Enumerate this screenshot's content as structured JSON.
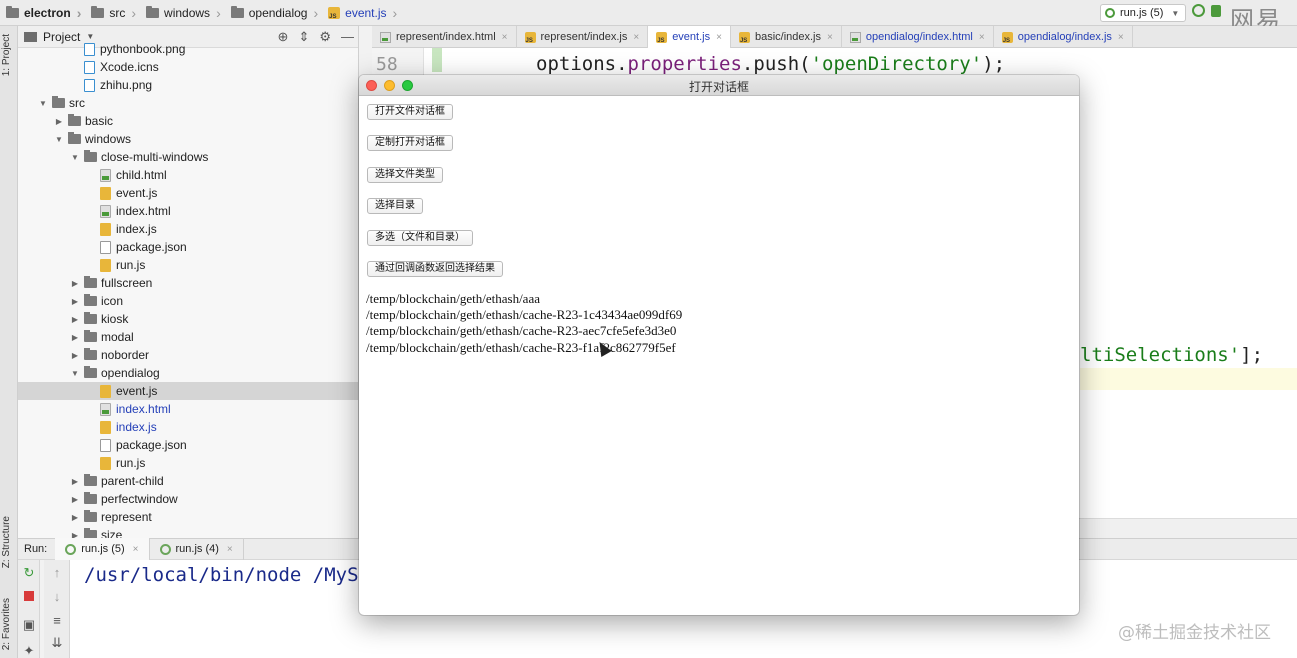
{
  "breadcrumb": {
    "items": [
      "electron",
      "src",
      "windows",
      "opendialog",
      "event.js"
    ]
  },
  "run_config": {
    "label": "run.js (5)"
  },
  "watermark_top": "网易",
  "side_strip": {
    "project": "1: Project",
    "structure": "Z: Structure",
    "favorites": "2: Favorites"
  },
  "project_panel": {
    "title": "Project",
    "tree": [
      {
        "label": "pythonbook.png",
        "type": "png",
        "depth": 3,
        "expanded": null
      },
      {
        "label": "Xcode.icns",
        "type": "png",
        "depth": 3,
        "expanded": null
      },
      {
        "label": "zhihu.png",
        "type": "png",
        "depth": 3,
        "expanded": null
      },
      {
        "label": "src",
        "type": "folder",
        "depth": 1,
        "expanded": true
      },
      {
        "label": "basic",
        "type": "folder",
        "depth": 2,
        "expanded": false
      },
      {
        "label": "windows",
        "type": "folder",
        "depth": 2,
        "expanded": true
      },
      {
        "label": "close-multi-windows",
        "type": "folder",
        "depth": 3,
        "expanded": true
      },
      {
        "label": "child.html",
        "type": "html",
        "depth": 4,
        "expanded": null
      },
      {
        "label": "event.js",
        "type": "js",
        "depth": 4,
        "expanded": null
      },
      {
        "label": "index.html",
        "type": "html",
        "depth": 4,
        "expanded": null
      },
      {
        "label": "index.js",
        "type": "js",
        "depth": 4,
        "expanded": null
      },
      {
        "label": "package.json",
        "type": "json",
        "depth": 4,
        "expanded": null
      },
      {
        "label": "run.js",
        "type": "js",
        "depth": 4,
        "expanded": null
      },
      {
        "label": "fullscreen",
        "type": "folder",
        "depth": 3,
        "expanded": false
      },
      {
        "label": "icon",
        "type": "folder",
        "depth": 3,
        "expanded": false
      },
      {
        "label": "kiosk",
        "type": "folder",
        "depth": 3,
        "expanded": false
      },
      {
        "label": "modal",
        "type": "folder",
        "depth": 3,
        "expanded": false
      },
      {
        "label": "noborder",
        "type": "folder",
        "depth": 3,
        "expanded": false
      },
      {
        "label": "opendialog",
        "type": "folder",
        "depth": 3,
        "expanded": true
      },
      {
        "label": "event.js",
        "type": "js",
        "depth": 4,
        "expanded": null,
        "selected": true
      },
      {
        "label": "index.html",
        "type": "html",
        "depth": 4,
        "expanded": null,
        "modified": true
      },
      {
        "label": "index.js",
        "type": "js",
        "depth": 4,
        "expanded": null,
        "modified": true
      },
      {
        "label": "package.json",
        "type": "json",
        "depth": 4,
        "expanded": null
      },
      {
        "label": "run.js",
        "type": "js",
        "depth": 4,
        "expanded": null
      },
      {
        "label": "parent-child",
        "type": "folder",
        "depth": 3,
        "expanded": false
      },
      {
        "label": "perfectwindow",
        "type": "folder",
        "depth": 3,
        "expanded": false
      },
      {
        "label": "represent",
        "type": "folder",
        "depth": 3,
        "expanded": false
      },
      {
        "label": "size",
        "type": "folder",
        "depth": 3,
        "expanded": false
      }
    ]
  },
  "editor_tabs": [
    {
      "label": "represent/index.html",
      "icon": "html",
      "active": false,
      "modified": false
    },
    {
      "label": "represent/index.js",
      "icon": "js",
      "active": false,
      "modified": false
    },
    {
      "label": "event.js",
      "icon": "js",
      "active": true,
      "modified": true
    },
    {
      "label": "basic/index.js",
      "icon": "js",
      "active": false,
      "modified": false
    },
    {
      "label": "opendialog/index.html",
      "icon": "html",
      "active": false,
      "modified": true
    },
    {
      "label": "opendialog/index.js",
      "icon": "js",
      "active": false,
      "modified": true
    }
  ],
  "editor": {
    "line_number": "58",
    "line1_obj": "options",
    "line1_prop": "properties",
    "line1_method": "push",
    "line1_arg": "'openDirectory'",
    "line1_end": ");",
    "line2_fragment": "ltiSelections'",
    "line2_end": "];"
  },
  "run_panel": {
    "label": "Run:",
    "tabs": [
      {
        "label": "run.js (5)",
        "active": true
      },
      {
        "label": "run.js (4)",
        "active": false
      }
    ],
    "console_text": "/usr/local/bin/node /MySt"
  },
  "dialog": {
    "title": "打开对话框",
    "buttons": [
      "打开文件对话框",
      "定制打开对话框",
      "选择文件类型",
      "选择目录",
      "多选（文件和目录）",
      "通过回调函数返回选择结果"
    ],
    "results": [
      "/temp/blockchain/geth/ethash/aaa",
      "/temp/blockchain/geth/ethash/cache-R23-1c43434ae099df69",
      "/temp/blockchain/geth/ethash/cache-R23-aec7cfe5efe3d3e0",
      "/temp/blockchain/geth/ethash/cache-R23-f1af2c862779f5ef"
    ]
  },
  "watermark_bottom": "@稀土掘金技术社区",
  "colors": {
    "accent_blue": "#2540b8",
    "string_green": "#1a7d1a",
    "keyword_purple": "#7a1f7a",
    "traffic_red": "#fc5f57",
    "traffic_yellow": "#fdbc2e",
    "traffic_green": "#29c940"
  }
}
